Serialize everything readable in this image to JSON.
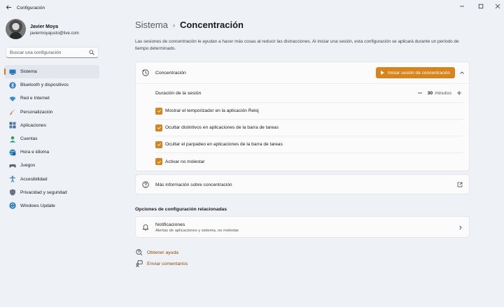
{
  "window": {
    "title": "Configuración",
    "controls": [
      "minimize",
      "maximize",
      "close"
    ]
  },
  "profile": {
    "name": "Javier Moya",
    "email": "javiermoyajusto@live.com"
  },
  "search": {
    "placeholder": "Buscar una configuración"
  },
  "sidebar": {
    "items": [
      {
        "label": "Sistema",
        "icon": "system-icon",
        "active": true
      },
      {
        "label": "Bluetooth y dispositivos",
        "icon": "bluetooth-icon"
      },
      {
        "label": "Red e Internet",
        "icon": "wifi-icon"
      },
      {
        "label": "Personalización",
        "icon": "brush-icon"
      },
      {
        "label": "Aplicaciones",
        "icon": "apps-icon"
      },
      {
        "label": "Cuentas",
        "icon": "account-icon"
      },
      {
        "label": "Hora e idioma",
        "icon": "globe-clock-icon"
      },
      {
        "label": "Juegos",
        "icon": "gamepad-icon"
      },
      {
        "label": "Accesibilidad",
        "icon": "accessibility-icon"
      },
      {
        "label": "Privacidad y seguridad",
        "icon": "shield-icon"
      },
      {
        "label": "Windows Update",
        "icon": "update-icon"
      }
    ]
  },
  "breadcrumb": {
    "parent": "Sistema",
    "separator": "›",
    "current": "Concentración"
  },
  "description": "Las sesiones de concentración le ayudan a hacer más cosas al reducir las distracciones. Al iniciar una sesión, esta configuración se aplicará durante un período de tiempo determinado.",
  "focus_card": {
    "title": "Concentración",
    "start_button": "Iniciar sesión de concentración",
    "duration": {
      "label": "Duración de la sesión",
      "value": "30",
      "unit": "minutos"
    },
    "options": [
      {
        "label": "Mostrar el temporizador en la aplicación Reloj",
        "checked": true
      },
      {
        "label": "Ocultar distintivos en aplicaciones de la barra de tareas",
        "checked": true
      },
      {
        "label": "Ocultar el parpadeo en aplicaciones de la barra de tareas",
        "checked": true
      },
      {
        "label": "Activar no molestar",
        "checked": true
      }
    ]
  },
  "more_info": {
    "label": "Más información sobre concentración"
  },
  "related": {
    "title": "Opciones de configuración relacionadas",
    "notifications": {
      "title": "Notificaciones",
      "subtitle": "Alertas de aplicaciones y sistema, no molestar"
    }
  },
  "links": {
    "help": "Obtener ayuda",
    "feedback": "Enviar comentarios"
  },
  "colors": {
    "accent": "#d8841d",
    "link": "#8a4f00",
    "background": "#eef1f6"
  }
}
